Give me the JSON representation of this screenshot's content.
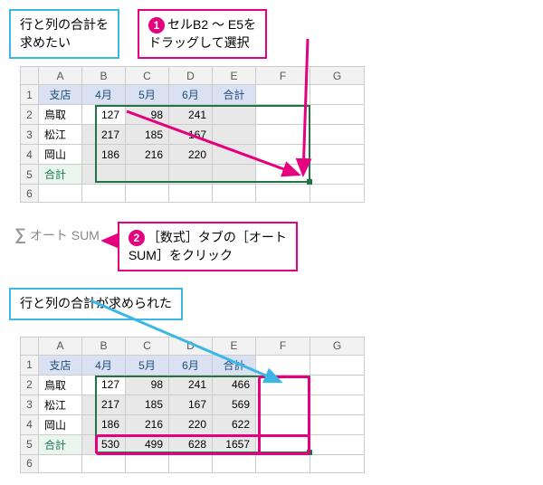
{
  "callouts": {
    "goal_line1": "行と列の合計を",
    "goal_line2": "求めたい",
    "step1_num": "1",
    "step1_line1": "セルB2 〜 E5を",
    "step1_line2": "ドラッグして選択",
    "step2_num": "2",
    "step2_line1": "［数式］タブの［オート",
    "step2_line2": "SUM］をクリック",
    "result_text": "行と列の合計が求められた"
  },
  "autosum": {
    "label": "オート SUM"
  },
  "columns": {
    "A": "A",
    "B": "B",
    "C": "C",
    "D": "D",
    "E": "E",
    "F": "F",
    "G": "G"
  },
  "rows": {
    "r1": "1",
    "r2": "2",
    "r3": "3",
    "r4": "4",
    "r5": "5",
    "r6": "6"
  },
  "headers": {
    "branch": "支店",
    "m4": "4月",
    "m5": "5月",
    "m6": "6月",
    "total": "合計"
  },
  "data": {
    "tottori": {
      "name": "鳥取",
      "m4": "127",
      "m5": "98",
      "m6": "241",
      "total": "466"
    },
    "matsue": {
      "name": "松江",
      "m4": "217",
      "m5": "185",
      "m6": "167",
      "total": "569"
    },
    "okayama": {
      "name": "岡山",
      "m4": "186",
      "m5": "216",
      "m6": "220",
      "total": "622"
    },
    "totals": {
      "label": "合計",
      "m4": "530",
      "m5": "499",
      "m6": "628",
      "grand": "1657"
    }
  }
}
